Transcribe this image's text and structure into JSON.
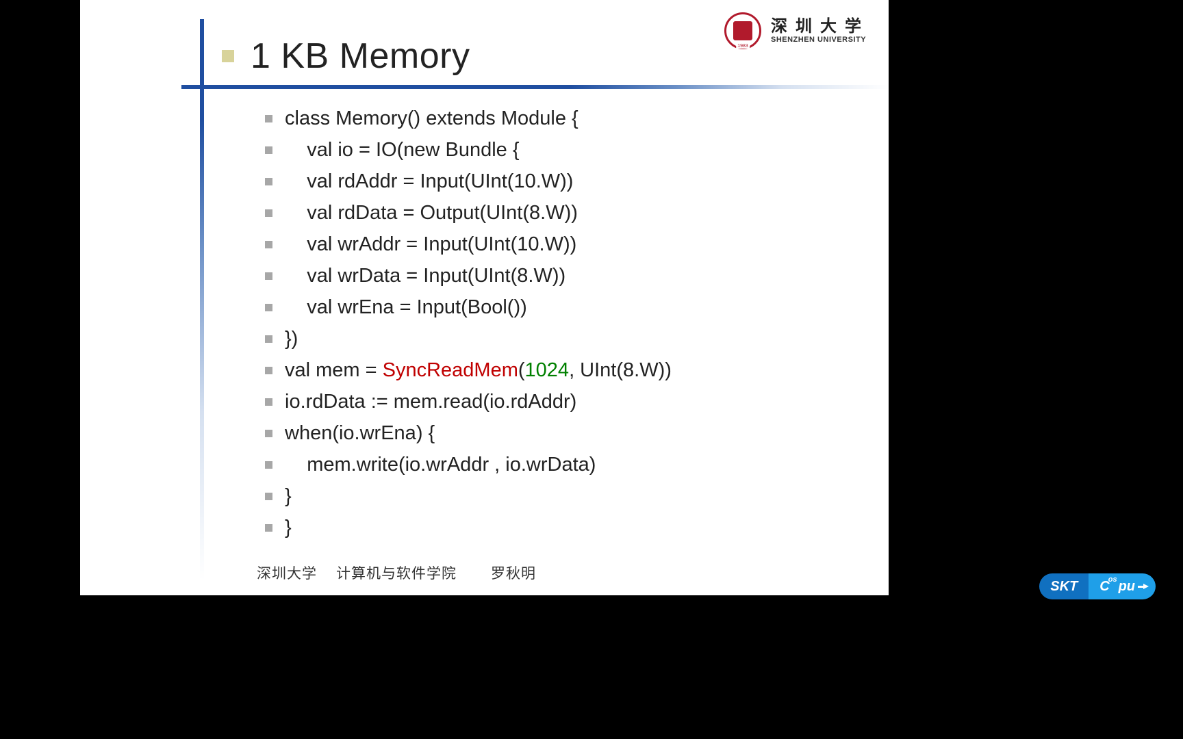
{
  "title": "1 KB Memory",
  "logo": {
    "cn": "深圳大学",
    "en": "SHENZHEN UNIVERSITY",
    "year": "1983"
  },
  "code": {
    "l0": "class Memory() extends Module {",
    "l1": "    val io = IO(new Bundle {",
    "l2": "    val rdAddr = Input(UInt(10.W))",
    "l3": "    val rdData = Output(UInt(8.W))",
    "l4": "    val wrAddr = Input(UInt(10.W))",
    "l5": "    val wrData = Input(UInt(8.W))",
    "l6": "    val wrEna = Input(Bool())",
    "l7": "})",
    "l8a": "val mem = ",
    "l8b": "SyncReadMem",
    "l8c": "(",
    "l8d": "1024",
    "l8e": ", UInt(8.W))",
    "l9": "io.rdData := mem.read(io.rdAddr)",
    "l10": "when(io.wrEna) {",
    "l11": "    mem.write(io.wrAddr , io.wrData)",
    "l12": "}",
    "l13": "}"
  },
  "footer": {
    "univ": "深圳大学",
    "college": "计算机与软件学院",
    "author": "罗秋明"
  },
  "badge": {
    "left": "SKT",
    "right_main": "C",
    "right_os": "os",
    "right_pu": "pu"
  }
}
